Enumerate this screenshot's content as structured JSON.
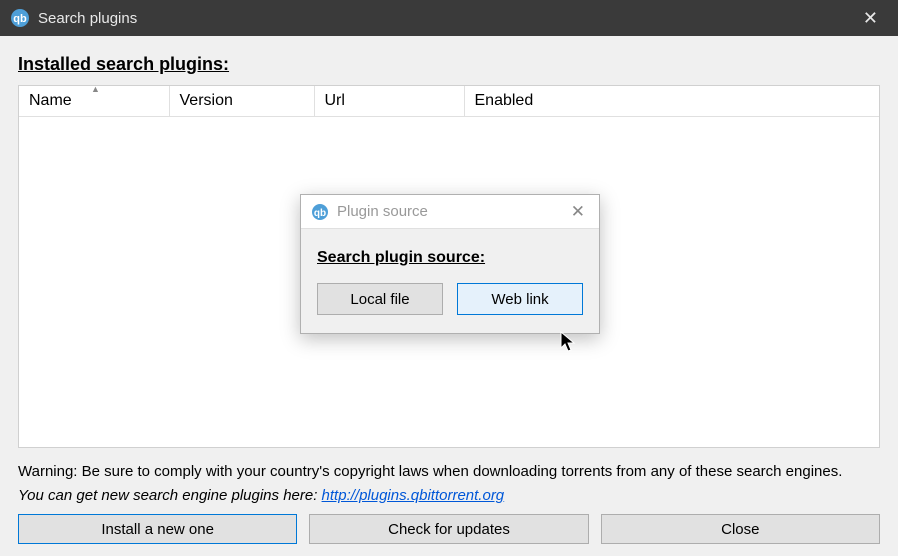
{
  "window": {
    "title": "Search plugins",
    "close_symbol": "✕"
  },
  "main": {
    "heading": "Installed search plugins:",
    "columns": {
      "name": "Name",
      "version": "Version",
      "url": "Url",
      "enabled": "Enabled"
    },
    "warning": "Warning: Be sure to comply with your country's copyright laws when downloading torrents from any of these search engines.",
    "hint_prefix": "You can get new search engine plugins here: ",
    "hint_link_text": "http://plugins.qbittorrent.org",
    "buttons": {
      "install": "Install a new one",
      "check_updates": "Check for updates",
      "close": "Close"
    }
  },
  "dialog": {
    "title": "Plugin source",
    "close_symbol": "✕",
    "heading": "Search plugin source:",
    "buttons": {
      "local_file": "Local file",
      "web_link": "Web link"
    }
  }
}
